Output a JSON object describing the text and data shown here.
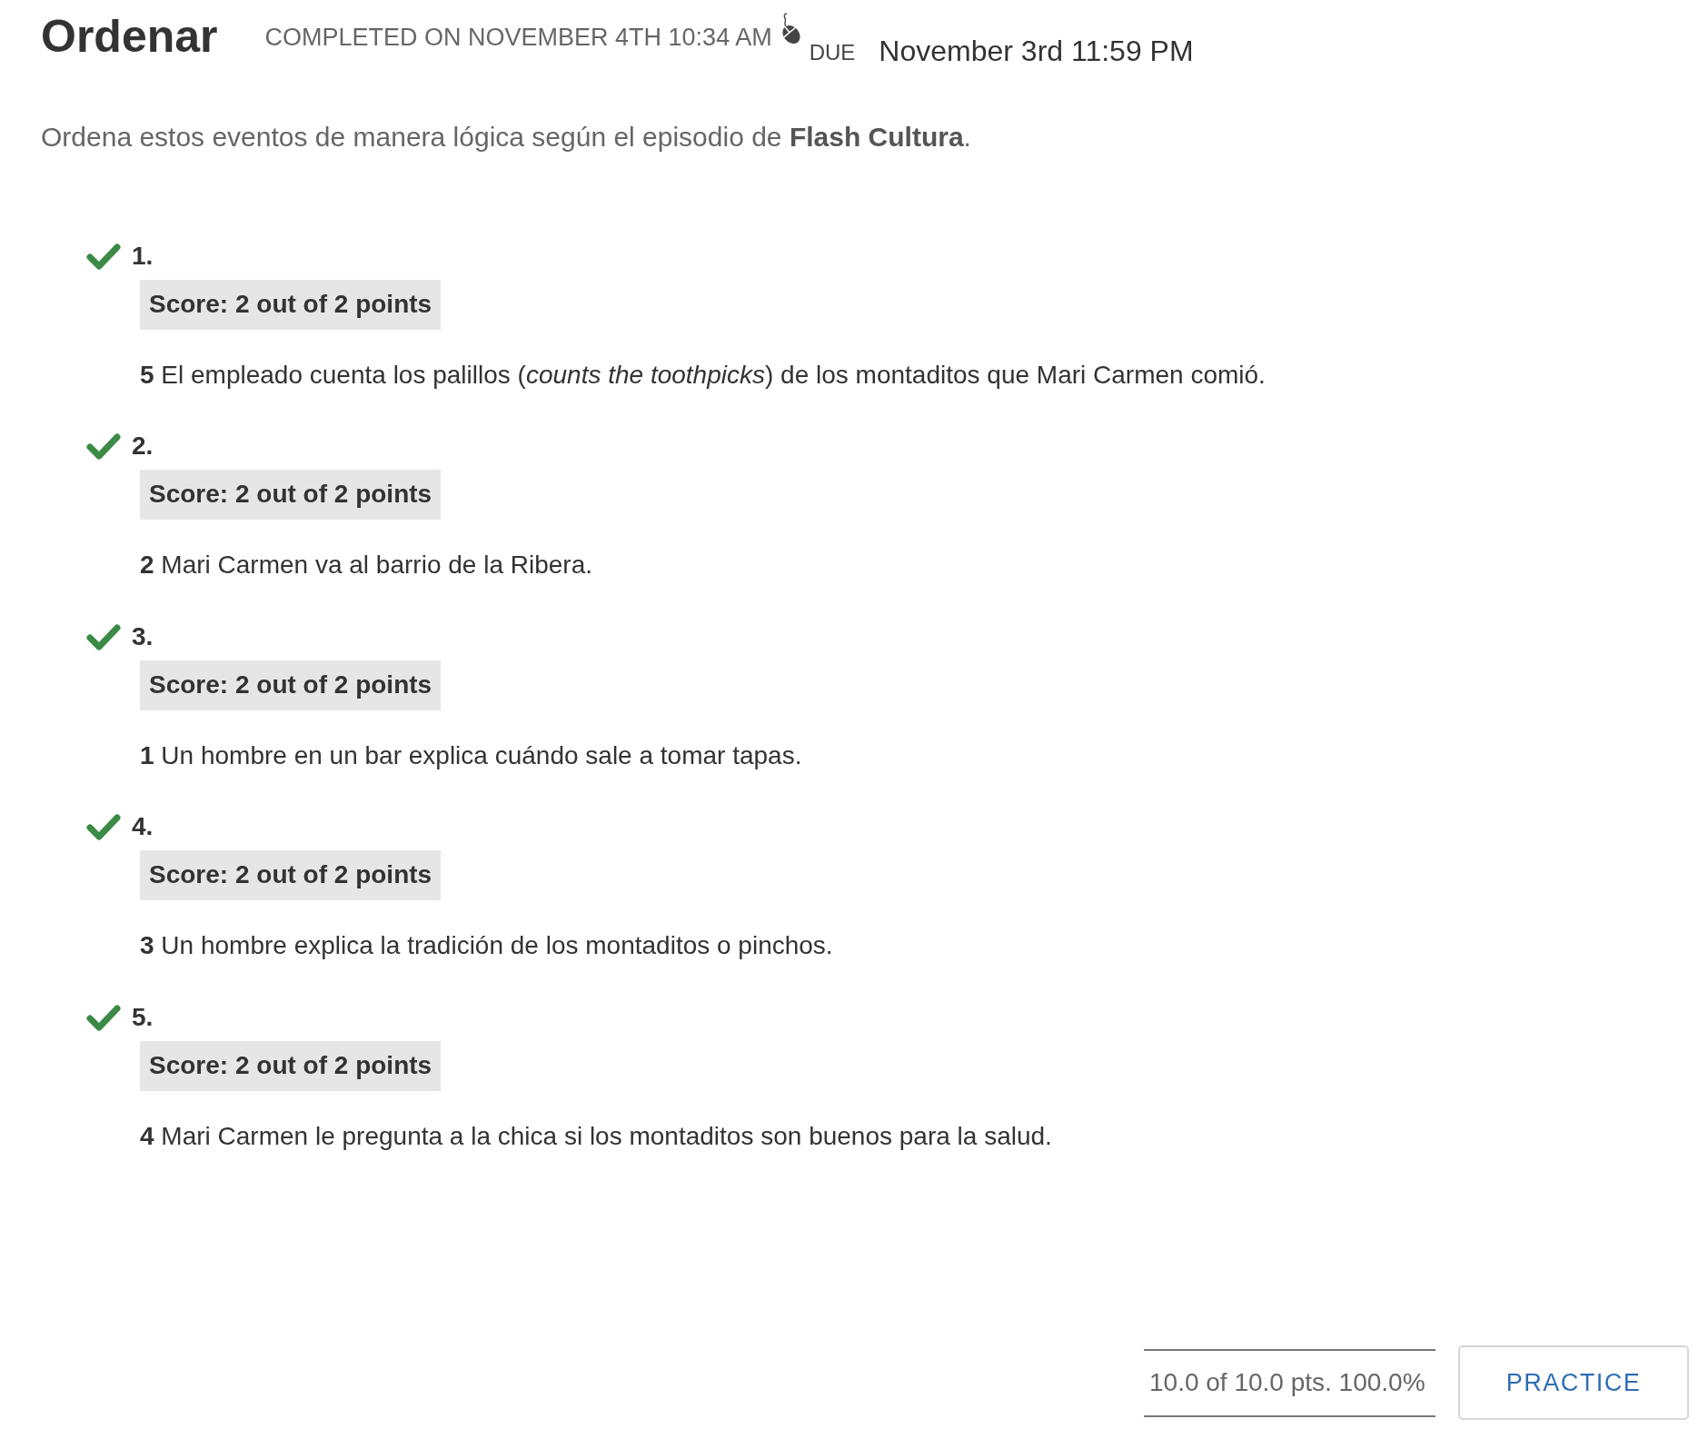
{
  "header": {
    "title": "Ordenar",
    "completed": "COMPLETED ON NOVEMBER 4TH 10:34 AM",
    "due_label": "DUE",
    "due_date": "November 3rd 11:59 PM"
  },
  "instructions": "Ordena estos eventos de manera lógica según el episodio de **Flash Cultura**.",
  "questions": [
    {
      "number": "1.",
      "correct": true,
      "score": "Score: 2 out of 2 points",
      "answer": "**5** El empleado cuenta los palillos (*counts the toothpicks*) de los montaditos que Mari Carmen comió."
    },
    {
      "number": "2.",
      "correct": true,
      "score": "Score: 2 out of 2 points",
      "answer": "**2** Mari Carmen va al barrio de la Ribera."
    },
    {
      "number": "3.",
      "correct": true,
      "score": "Score: 2 out of 2 points",
      "answer": "**1** Un hombre en un bar explica cuándo sale a tomar tapas."
    },
    {
      "number": "4.",
      "correct": true,
      "score": "Score: 2 out of 2 points",
      "answer": "**3** Un hombre explica la tradición de los montaditos o pinchos."
    },
    {
      "number": "5.",
      "correct": true,
      "score": "Score: 2 out of 2 points",
      "answer": "**4** Mari Carmen le pregunta a la chica si los montaditos son buenos para la salud."
    }
  ],
  "footer": {
    "total": "10.0 of 10.0 pts. 100.0%",
    "button": "PRACTICE"
  }
}
